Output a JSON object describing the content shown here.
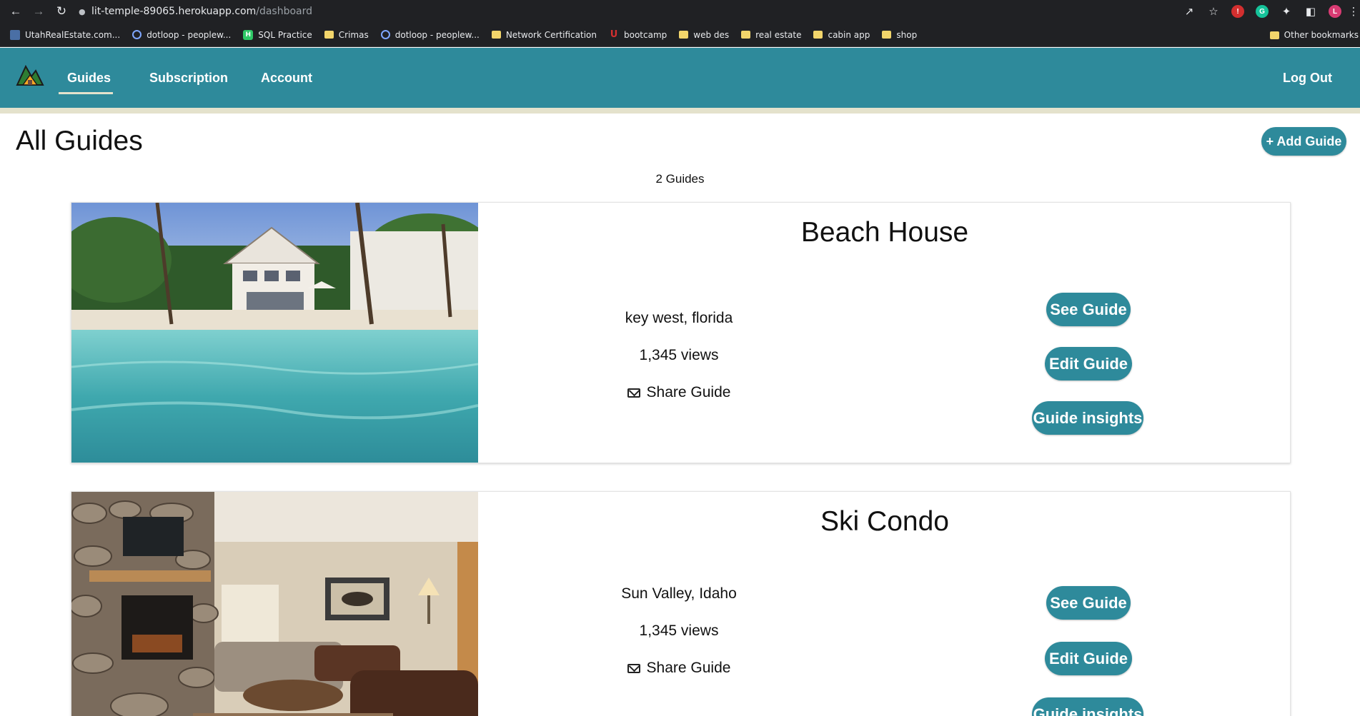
{
  "browser": {
    "url_host": "lit-temple-89065.herokuapp.com",
    "url_path": "/dashboard",
    "profile_initial": "L",
    "bookmarks": [
      {
        "label": "UtahRealEstate.com...",
        "icon": "site-icon"
      },
      {
        "label": "dotloop - peoplew...",
        "icon": "dotloop-icon"
      },
      {
        "label": "SQL Practice",
        "icon": "hackerrank-icon"
      },
      {
        "label": "Crimas",
        "icon": "folder-icon"
      },
      {
        "label": "dotloop - peoplew...",
        "icon": "dotloop-icon"
      },
      {
        "label": "Network Certification",
        "icon": "folder-icon"
      },
      {
        "label": "bootcamp",
        "icon": "utah-u-icon"
      },
      {
        "label": "web des",
        "icon": "folder-icon"
      },
      {
        "label": "real estate",
        "icon": "folder-icon"
      },
      {
        "label": "cabin app",
        "icon": "folder-icon"
      },
      {
        "label": "shop",
        "icon": "folder-icon"
      }
    ],
    "other_bookmarks": "Other bookmarks"
  },
  "navbar": {
    "links": {
      "guides": "Guides",
      "subscription": "Subscription",
      "account": "Account"
    },
    "logout": "Log Out",
    "active": "Guides",
    "colors": {
      "bar": "#2e8a9b",
      "stripe": "#e4e2cc"
    }
  },
  "page": {
    "title": "All Guides",
    "add_button": "+ Add Guide",
    "count": "2 Guides"
  },
  "guides": [
    {
      "title": "Beach House",
      "location": "key west, florida",
      "views": "1,345 views",
      "share": "Share Guide",
      "buttons": {
        "see": "See Guide",
        "edit": "Edit Guide",
        "insights": "Guide insights"
      }
    },
    {
      "title": "Ski Condo",
      "location": "Sun Valley, Idaho",
      "views": "1,345 views",
      "share": "Share Guide",
      "buttons": {
        "see": "See Guide",
        "edit": "Edit Guide",
        "insights": "Guide insights"
      }
    }
  ]
}
